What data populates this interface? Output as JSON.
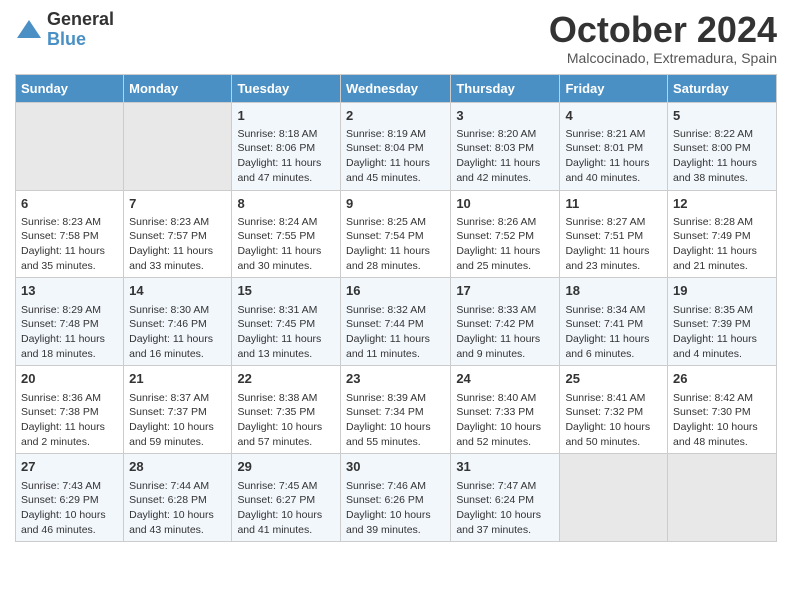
{
  "logo": {
    "general": "General",
    "blue": "Blue"
  },
  "title": "October 2024",
  "subtitle": "Malcocinado, Extremadura, Spain",
  "headers": [
    "Sunday",
    "Monday",
    "Tuesday",
    "Wednesday",
    "Thursday",
    "Friday",
    "Saturday"
  ],
  "weeks": [
    [
      {
        "day": "",
        "info": ""
      },
      {
        "day": "",
        "info": ""
      },
      {
        "day": "1",
        "info": "Sunrise: 8:18 AM\nSunset: 8:06 PM\nDaylight: 11 hours and 47 minutes."
      },
      {
        "day": "2",
        "info": "Sunrise: 8:19 AM\nSunset: 8:04 PM\nDaylight: 11 hours and 45 minutes."
      },
      {
        "day": "3",
        "info": "Sunrise: 8:20 AM\nSunset: 8:03 PM\nDaylight: 11 hours and 42 minutes."
      },
      {
        "day": "4",
        "info": "Sunrise: 8:21 AM\nSunset: 8:01 PM\nDaylight: 11 hours and 40 minutes."
      },
      {
        "day": "5",
        "info": "Sunrise: 8:22 AM\nSunset: 8:00 PM\nDaylight: 11 hours and 38 minutes."
      }
    ],
    [
      {
        "day": "6",
        "info": "Sunrise: 8:23 AM\nSunset: 7:58 PM\nDaylight: 11 hours and 35 minutes."
      },
      {
        "day": "7",
        "info": "Sunrise: 8:23 AM\nSunset: 7:57 PM\nDaylight: 11 hours and 33 minutes."
      },
      {
        "day": "8",
        "info": "Sunrise: 8:24 AM\nSunset: 7:55 PM\nDaylight: 11 hours and 30 minutes."
      },
      {
        "day": "9",
        "info": "Sunrise: 8:25 AM\nSunset: 7:54 PM\nDaylight: 11 hours and 28 minutes."
      },
      {
        "day": "10",
        "info": "Sunrise: 8:26 AM\nSunset: 7:52 PM\nDaylight: 11 hours and 25 minutes."
      },
      {
        "day": "11",
        "info": "Sunrise: 8:27 AM\nSunset: 7:51 PM\nDaylight: 11 hours and 23 minutes."
      },
      {
        "day": "12",
        "info": "Sunrise: 8:28 AM\nSunset: 7:49 PM\nDaylight: 11 hours and 21 minutes."
      }
    ],
    [
      {
        "day": "13",
        "info": "Sunrise: 8:29 AM\nSunset: 7:48 PM\nDaylight: 11 hours and 18 minutes."
      },
      {
        "day": "14",
        "info": "Sunrise: 8:30 AM\nSunset: 7:46 PM\nDaylight: 11 hours and 16 minutes."
      },
      {
        "day": "15",
        "info": "Sunrise: 8:31 AM\nSunset: 7:45 PM\nDaylight: 11 hours and 13 minutes."
      },
      {
        "day": "16",
        "info": "Sunrise: 8:32 AM\nSunset: 7:44 PM\nDaylight: 11 hours and 11 minutes."
      },
      {
        "day": "17",
        "info": "Sunrise: 8:33 AM\nSunset: 7:42 PM\nDaylight: 11 hours and 9 minutes."
      },
      {
        "day": "18",
        "info": "Sunrise: 8:34 AM\nSunset: 7:41 PM\nDaylight: 11 hours and 6 minutes."
      },
      {
        "day": "19",
        "info": "Sunrise: 8:35 AM\nSunset: 7:39 PM\nDaylight: 11 hours and 4 minutes."
      }
    ],
    [
      {
        "day": "20",
        "info": "Sunrise: 8:36 AM\nSunset: 7:38 PM\nDaylight: 11 hours and 2 minutes."
      },
      {
        "day": "21",
        "info": "Sunrise: 8:37 AM\nSunset: 7:37 PM\nDaylight: 10 hours and 59 minutes."
      },
      {
        "day": "22",
        "info": "Sunrise: 8:38 AM\nSunset: 7:35 PM\nDaylight: 10 hours and 57 minutes."
      },
      {
        "day": "23",
        "info": "Sunrise: 8:39 AM\nSunset: 7:34 PM\nDaylight: 10 hours and 55 minutes."
      },
      {
        "day": "24",
        "info": "Sunrise: 8:40 AM\nSunset: 7:33 PM\nDaylight: 10 hours and 52 minutes."
      },
      {
        "day": "25",
        "info": "Sunrise: 8:41 AM\nSunset: 7:32 PM\nDaylight: 10 hours and 50 minutes."
      },
      {
        "day": "26",
        "info": "Sunrise: 8:42 AM\nSunset: 7:30 PM\nDaylight: 10 hours and 48 minutes."
      }
    ],
    [
      {
        "day": "27",
        "info": "Sunrise: 7:43 AM\nSunset: 6:29 PM\nDaylight: 10 hours and 46 minutes."
      },
      {
        "day": "28",
        "info": "Sunrise: 7:44 AM\nSunset: 6:28 PM\nDaylight: 10 hours and 43 minutes."
      },
      {
        "day": "29",
        "info": "Sunrise: 7:45 AM\nSunset: 6:27 PM\nDaylight: 10 hours and 41 minutes."
      },
      {
        "day": "30",
        "info": "Sunrise: 7:46 AM\nSunset: 6:26 PM\nDaylight: 10 hours and 39 minutes."
      },
      {
        "day": "31",
        "info": "Sunrise: 7:47 AM\nSunset: 6:24 PM\nDaylight: 10 hours and 37 minutes."
      },
      {
        "day": "",
        "info": ""
      },
      {
        "day": "",
        "info": ""
      }
    ]
  ]
}
